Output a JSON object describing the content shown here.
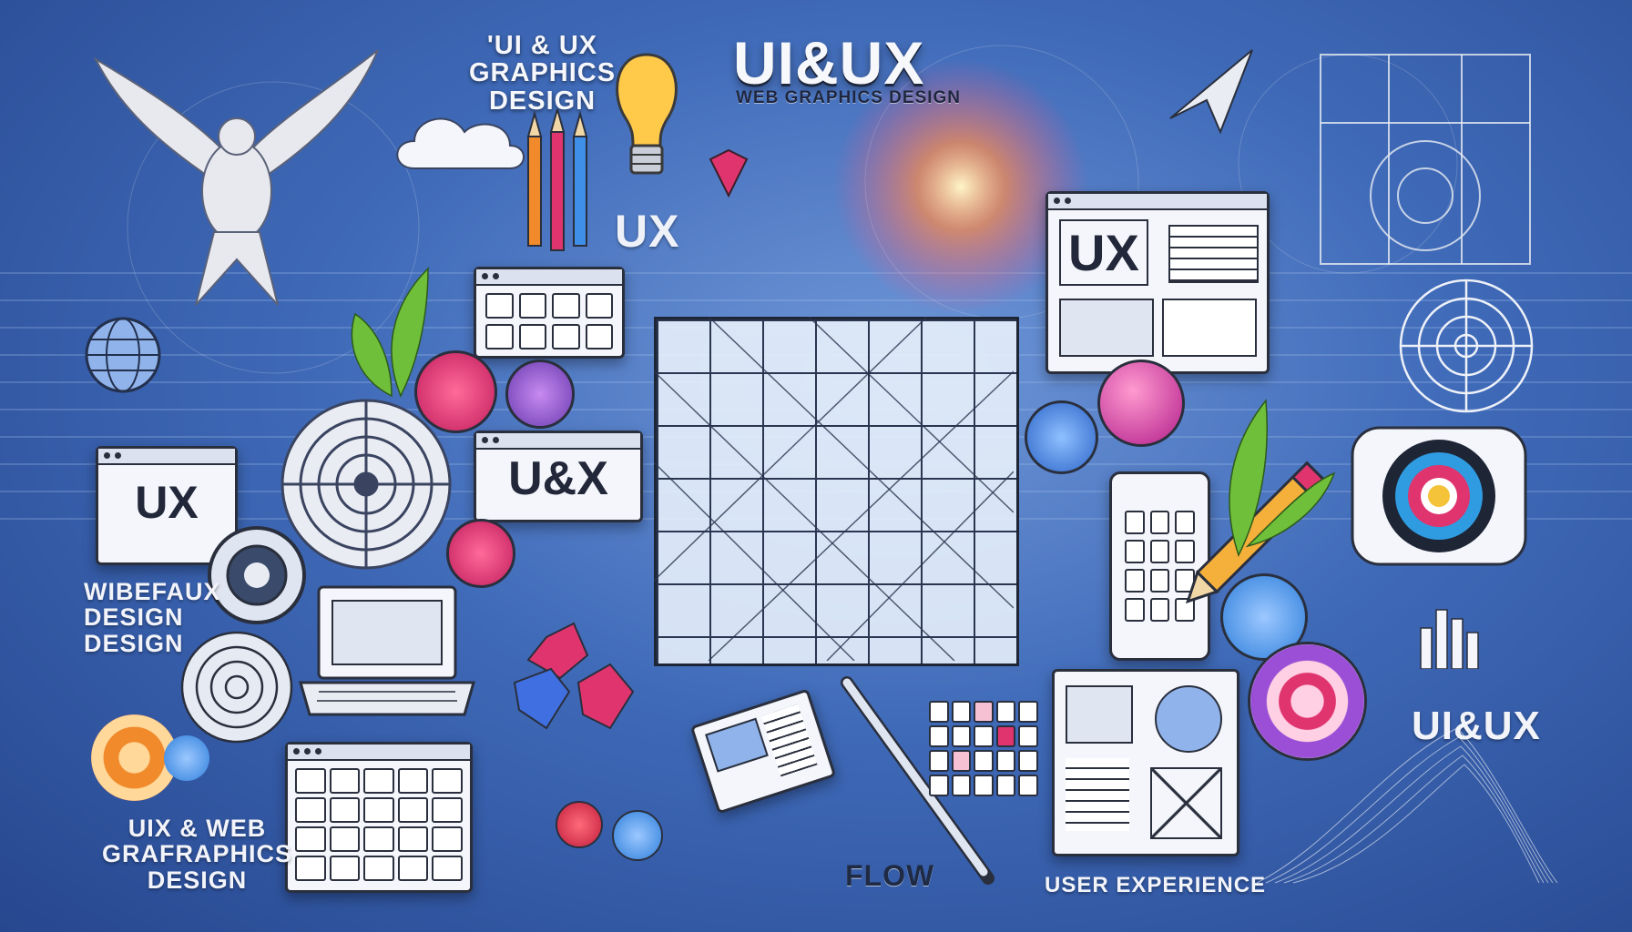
{
  "texts": {
    "top_left_title": "'UI & UX\nGRAPHICS\nDESIGN",
    "ux_mid": "UX",
    "main_title": "UI&UX",
    "main_subtitle": "WEB GRAPHICS DESIGN",
    "window_ux_left": "UX",
    "window_ux_center": "U&X",
    "window_ux_right": "UX",
    "left_design": "WIBEFAUX\nDESIGN\nDESIGN",
    "bottom_left": "UIX & WEB\nGRAFRAPHICS\nDESIGN",
    "flow": "FLOW",
    "user_experience": "USER EXPERIENCE",
    "right_uiux": "UI&UX"
  },
  "colors": {
    "background_center": "#6f97d8",
    "background_edge": "#27478f",
    "accent_pink": "#e0346e",
    "accent_blue": "#3f8fe8",
    "accent_orange": "#f08a2a",
    "accent_purple": "#9a4fd6"
  },
  "icons": [
    "dove-icon",
    "cloud-icon",
    "lightbulb-icon",
    "pencils-icon",
    "globe-icon",
    "target-icon",
    "laptop-icon",
    "smartphone-icon",
    "pencil-icon",
    "calendar-grid-icon",
    "gem-icon",
    "leaf-icon",
    "paper-plane-icon"
  ]
}
